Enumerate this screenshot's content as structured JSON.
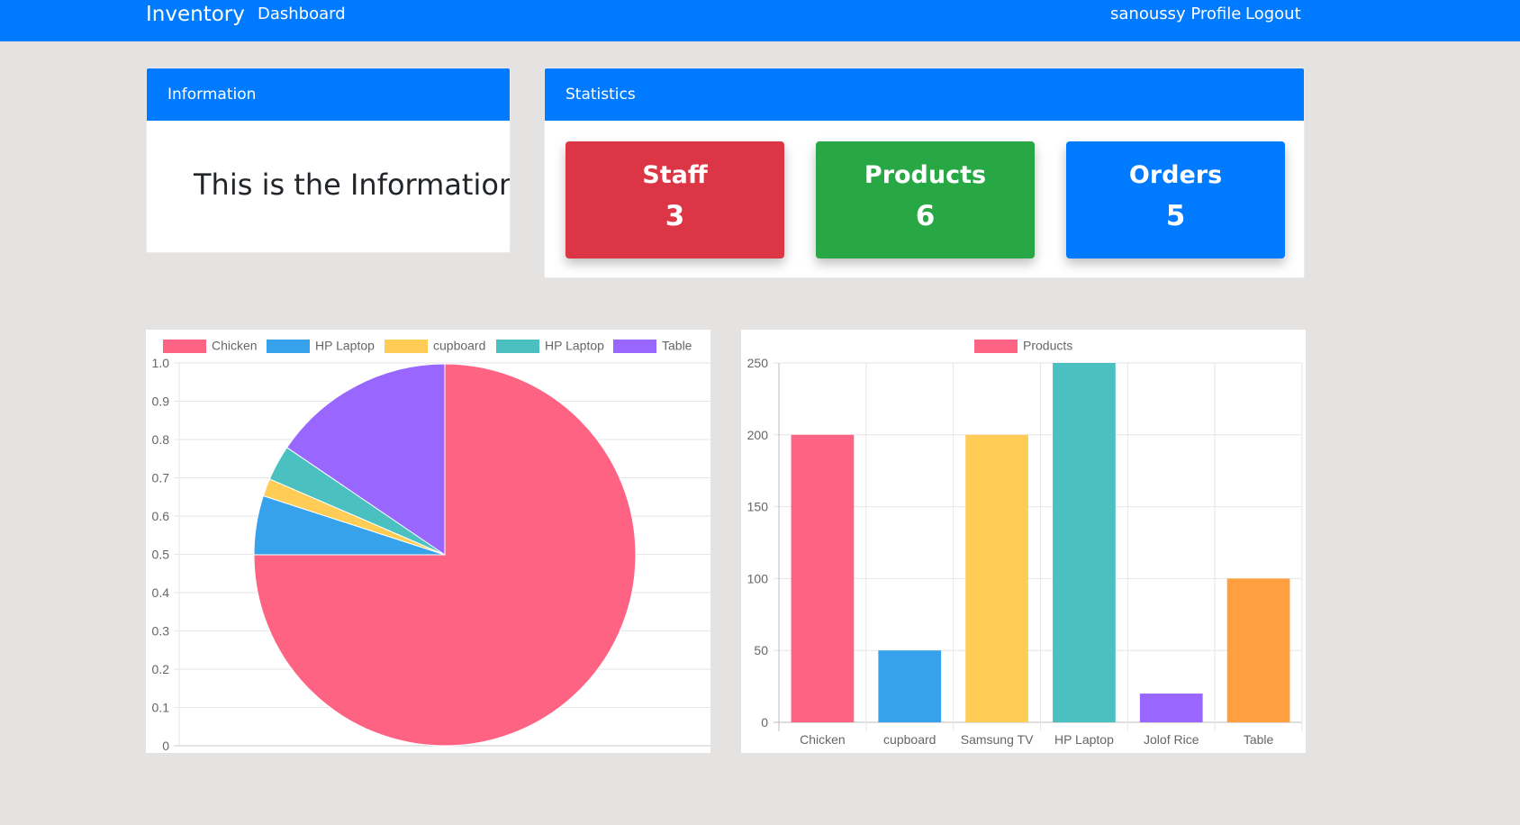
{
  "navbar": {
    "brand": "Inventory",
    "dashboard_link": "Dashboard",
    "profile_link": "sanoussy Profile",
    "logout_link": "Logout"
  },
  "information_card": {
    "header": "Information",
    "text": "This is the Information"
  },
  "statistics_card": {
    "header": "Statistics",
    "stats": [
      {
        "label": "Staff",
        "value": "3",
        "color": "#dc3545"
      },
      {
        "label": "Products",
        "value": "6",
        "color": "#28a745"
      },
      {
        "label": "Orders",
        "value": "5",
        "color": "#007bff"
      }
    ]
  },
  "colors": {
    "primary": "#007bff",
    "background": "#e4e3e1"
  },
  "chart_data": [
    {
      "type": "pie",
      "legend": [
        "Chicken",
        "HP Laptop",
        "cupboard",
        "HP Laptop",
        "Table"
      ],
      "values": [
        75,
        5,
        1.5,
        3,
        15.5
      ],
      "colors": [
        "#ff6384",
        "#36a2eb",
        "#ffcd56",
        "#4bc0c0",
        "#9966ff"
      ],
      "y_ticks": [
        "1.0",
        "0.9",
        "0.8",
        "0.7",
        "0.6",
        "0.5",
        "0.4",
        "0.3",
        "0.2",
        "0.1",
        "0"
      ],
      "ylim": [
        0,
        1
      ],
      "legend_position": "top"
    },
    {
      "type": "bar",
      "series": [
        {
          "name": "Products",
          "values": [
            200,
            50,
            200,
            250,
            20,
            100
          ]
        }
      ],
      "categories": [
        "Chicken",
        "cupboard",
        "Samsung TV",
        "HP Laptop",
        "Jolof Rice",
        "Table"
      ],
      "colors": [
        "#ff6384",
        "#36a2eb",
        "#ffcd56",
        "#4bc0c0",
        "#9966ff",
        "#ff9f40"
      ],
      "y_ticks": [
        "250",
        "200",
        "150",
        "100",
        "50",
        "0"
      ],
      "ylim": [
        0,
        250
      ],
      "legend_position": "top"
    }
  ]
}
